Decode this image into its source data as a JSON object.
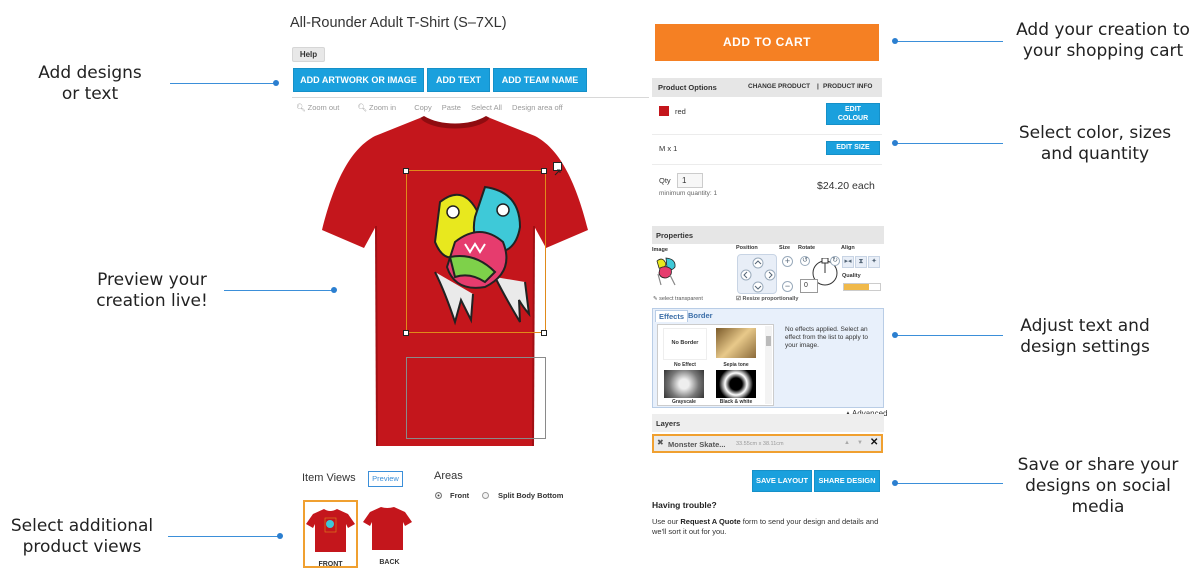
{
  "annotations": {
    "add_designs": "Add designs\nor text",
    "preview": "Preview your\ncreation live!",
    "additional_views": "Select additional\nproduct views",
    "add_to_cart": "Add your creation to\nyour shopping cart",
    "select_options": "Select color, sizes\nand quantity",
    "adjust_settings": "Adjust text and\ndesign settings",
    "save_share": "Save or share your\ndesigns on social\nmedia"
  },
  "designer": {
    "product_title": "All-Rounder Adult T-Shirt (S–7XL)",
    "help_label": "Help",
    "buttons": {
      "add_artwork": "ADD ARTWORK OR IMAGE",
      "add_text": "ADD TEXT",
      "add_team_name": "ADD TEAM NAME"
    },
    "tools": [
      "Zoom out",
      "Zoom in",
      "Copy",
      "Paste",
      "Select All",
      "Design area off"
    ],
    "shirt_color": "#c4161c",
    "item_views_label": "Item Views",
    "preview_label": "Preview",
    "areas_label": "Areas",
    "areas": [
      {
        "label": "Front",
        "selected": true
      },
      {
        "label": "Split Body Bottom",
        "selected": false
      }
    ],
    "views": [
      {
        "label": "FRONT",
        "active": true
      },
      {
        "label": "BACK",
        "active": false
      }
    ]
  },
  "cart_panel": {
    "add_to_cart_label": "ADD TO CART",
    "accent_color": "#f58023",
    "product_options_label": "Product Options",
    "change_product_label": "CHANGE PRODUCT",
    "product_info_label": "PRODUCT INFO",
    "colour_name": "red",
    "edit_colour_label": "EDIT\nCOLOUR",
    "size_qty": "M x 1",
    "edit_size_label": "EDIT SIZE",
    "qty_label": "Qty",
    "qty_value": "1",
    "minimum_qty": "minimum quantity: 1",
    "price": "$24.20 each"
  },
  "properties": {
    "header": "Properties",
    "col_image": "Image",
    "col_position": "Position",
    "col_size": "Size",
    "col_rotate": "Rotate",
    "col_align": "Align",
    "quality_label": "Quality",
    "rotate_value": "0",
    "select_transparent": "select transparent",
    "resize_label": "Resize proportionally",
    "tabs": [
      "Effects",
      "Border"
    ],
    "effects": [
      "No Effect",
      "Sepia tone",
      "Grayscale",
      "Black & white"
    ],
    "no_border_label": "No Border",
    "effects_message": "No effects applied. Select an effect from the list to apply to your image.",
    "advanced_label": "Advanced"
  },
  "layers": {
    "header": "Layers",
    "item_name": "Monster Skate...",
    "item_size": "33.55cm x 38.11cm"
  },
  "actions": {
    "save_layout": "SAVE LAYOUT",
    "share_design": "SHARE DESIGN"
  },
  "help": {
    "title": "Having trouble?",
    "text_before": "Use our",
    "link": "Request A Quote",
    "text_after": "form to send your design and details and we'll sort it out for you."
  }
}
